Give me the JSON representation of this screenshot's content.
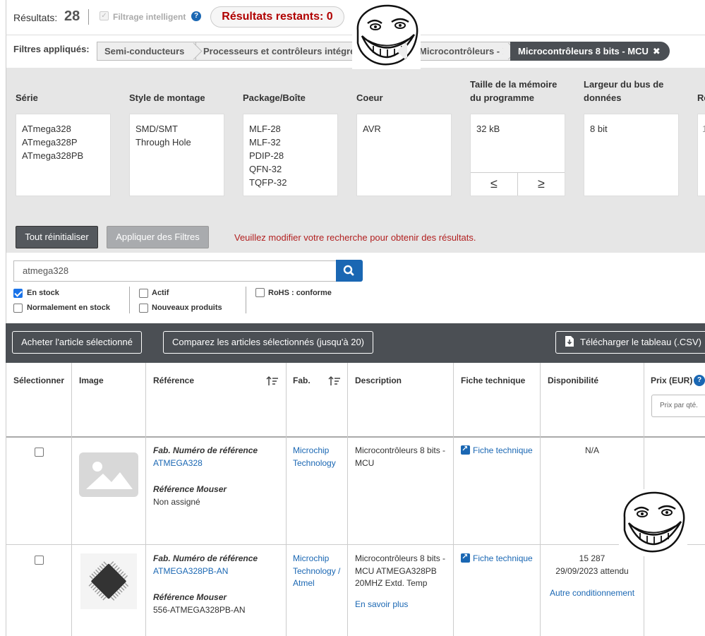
{
  "results": {
    "label": "Résultats:",
    "count": "28",
    "smart_filter_label": "Filtrage intelligent",
    "remaining": "Résultats restants: 0"
  },
  "applied_filters": {
    "label": "Filtres appliqués:",
    "crumbs": [
      "Semi-conducteurs",
      "Processeurs et contrôleurs intégrés",
      "Microcontrôleurs - MCU",
      "Microcontrôleurs 8 bits - MCU"
    ],
    "remove_icon": "✖"
  },
  "filters": {
    "columns": [
      {
        "title": "Série",
        "values": [
          "ATmega328",
          "ATmega328P",
          "ATmega328PB"
        ]
      },
      {
        "title": "Style de montage",
        "values": [
          "SMD/SMT",
          "Through Hole"
        ]
      },
      {
        "title": "Package/Boîte",
        "values": [
          "MLF-28",
          "MLF-32",
          "PDIP-28",
          "QFN-32",
          "TQFP-32"
        ]
      },
      {
        "title": "Coeur",
        "values": [
          "AVR"
        ]
      },
      {
        "title": "Taille de la mémoire du programme",
        "values": [
          "32 kB"
        ],
        "compare": [
          "≤",
          "≥"
        ]
      },
      {
        "title": "Largeur du bus de données",
        "values": [
          "8 bit"
        ]
      }
    ],
    "reset_label": "Tout réinitialiser",
    "apply_label": "Appliquer des Filtres",
    "message": "Veuillez modifier votre recherche pour obtenir des résultats."
  },
  "search": {
    "value": "atmega328",
    "checkboxes": {
      "in_stock": {
        "label": "En stock",
        "checked": true
      },
      "normally_in_stock": {
        "label": "Normalement en stock",
        "checked": false
      },
      "active": {
        "label": "Actif",
        "checked": false
      },
      "new_products": {
        "label": "Nouveaux produits",
        "checked": false
      },
      "rohs": {
        "label": "RoHS : conforme",
        "checked": false
      }
    }
  },
  "actions": {
    "buy": "Acheter l'article sélectionné",
    "compare": "Comparez les articles sélectionnés (jusqu'à 20)",
    "download": "Télécharger le tableau (.CSV)"
  },
  "table": {
    "headers": {
      "select": "Sélectionner",
      "image": "Image",
      "reference": "Référence",
      "manufacturer": "Fab.",
      "description": "Description",
      "datasheet": "Fiche technique",
      "availability": "Disponibilité",
      "price": "Prix (EUR)"
    },
    "price_placeholder": "Prix par qté.",
    "rows": [
      {
        "mfr_ref_label": "Fab. Numéro de référence",
        "mfr_ref": "ATMEGA328",
        "mouser_ref_label": "Référence Mouser",
        "mouser_ref": "Non assigné",
        "manufacturer": "Microchip Technology",
        "description": "Microcontrôleurs 8 bits - MCU",
        "datasheet": "Fiche technique",
        "availability": "N/A"
      },
      {
        "mfr_ref_label": "Fab. Numéro de référence",
        "mfr_ref": "ATMEGA328PB-AN",
        "mouser_ref_label": "Référence Mouser",
        "mouser_ref": "556-ATMEGA328PB-AN",
        "manufacturer": "Microchip Technology / Atmel",
        "description": "Microcontrôleurs 8 bits - MCU ATMEGA328PB 20MHZ Extd. Temp",
        "more": "En savoir plus",
        "datasheet": "Fiche technique",
        "availability_qty": "15 287",
        "availability_date": "29/09/2023 attendu",
        "other_packaging": "Autre conditionnement"
      }
    ]
  },
  "colors": {
    "accent": "#1a67b3",
    "alert": "#b00000",
    "dark_bar": "#4b4f54",
    "filter_bg": "#e6e6e6"
  }
}
